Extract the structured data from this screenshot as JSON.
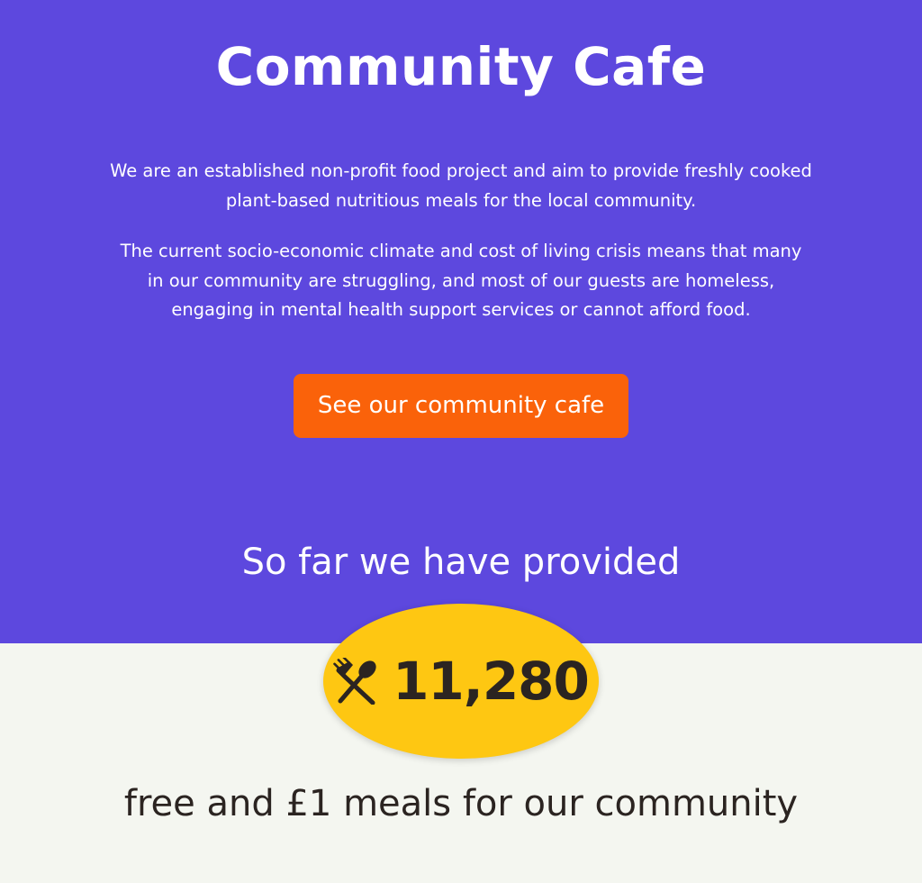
{
  "hero": {
    "title": "Community Cafe",
    "paragraph_1": "We are an established non-profit food project and aim to provide freshly cooked plant-based nutritious meals for the local community.",
    "paragraph_2": "The current socio-economic climate and cost of living crisis means that many in our community are struggling, and most of our guests are homeless, engaging in mental health support services or cannot afford food.",
    "cta_label": "See our community cafe",
    "subtitle": "So far we have provided"
  },
  "stats": {
    "icon": "utensils-icon",
    "meals_count": "11,280",
    "caption": "free and £1 meals for our community"
  },
  "colors": {
    "hero_background": "#5d48de",
    "cta_background": "#fa620a",
    "counter_background": "#fec712",
    "page_background": "#f4f6f0",
    "dark_text": "#2b2421"
  }
}
